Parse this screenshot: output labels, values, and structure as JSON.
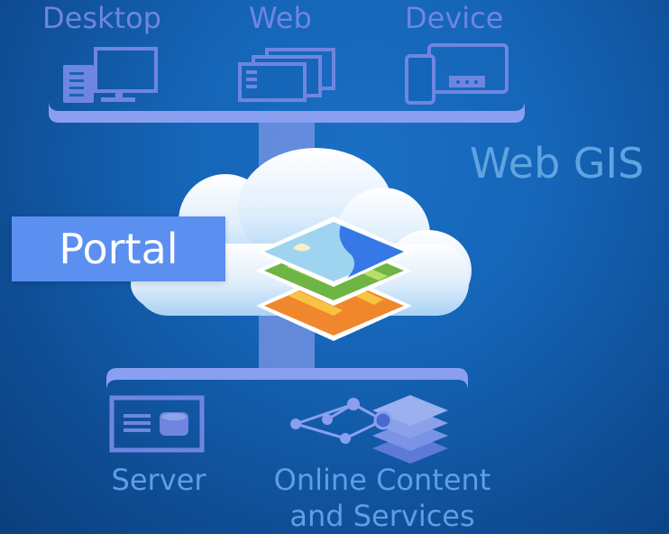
{
  "clients": {
    "desktop_label": "Desktop",
    "web_label": "Web",
    "device_label": "Device"
  },
  "center": {
    "portal_label": "Portal",
    "webgis_label": "Web GIS"
  },
  "backend": {
    "server_label": "Server",
    "online_label_line1": "Online Content",
    "online_label_line2": "and Services"
  },
  "icons": [
    "desktop-icon",
    "web-icon",
    "device-icon",
    "cloud-icon",
    "layers-icon",
    "server-icon",
    "network-layers-icon"
  ],
  "colors": {
    "background": "#1565b8",
    "icon_accent": "#6e86e0",
    "portal_box": "#5b8ff0",
    "webgis_text": "#5fa4e0"
  }
}
